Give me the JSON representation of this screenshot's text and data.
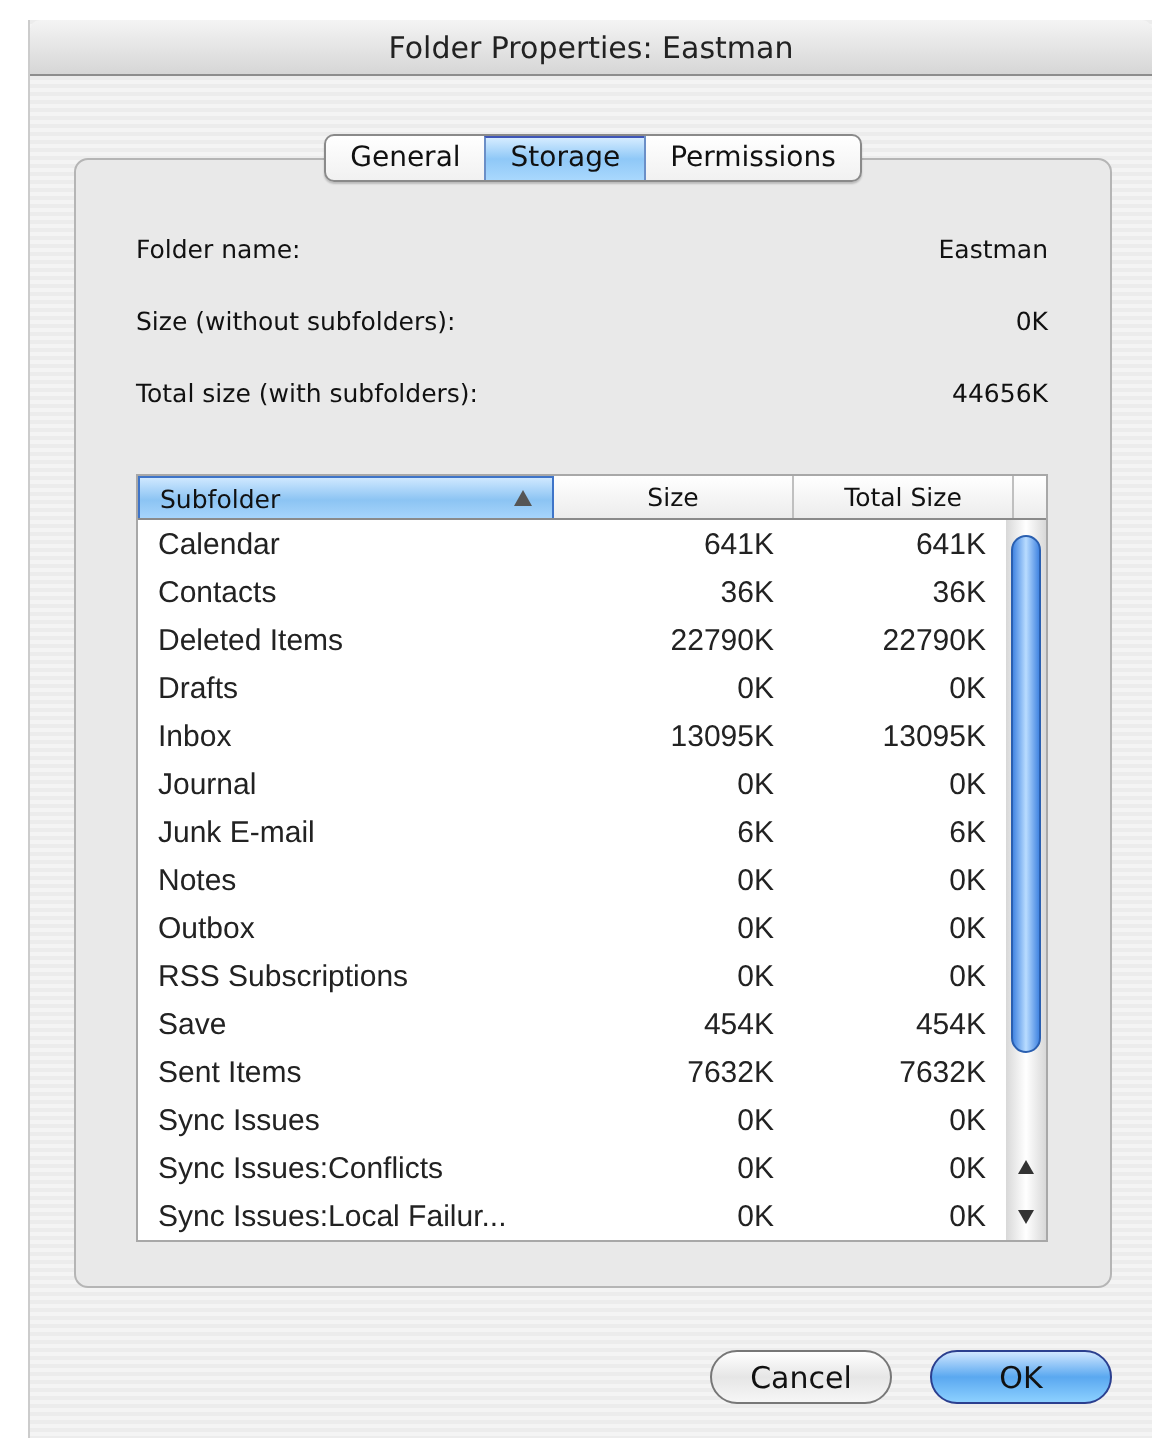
{
  "window": {
    "title": "Folder Properties: Eastman"
  },
  "tabs": [
    {
      "label": "General",
      "selected": false
    },
    {
      "label": "Storage",
      "selected": true
    },
    {
      "label": "Permissions",
      "selected": false
    }
  ],
  "info": [
    {
      "label": "Folder name:",
      "value": "Eastman"
    },
    {
      "label": "Size (without subfolders):",
      "value": "0K"
    },
    {
      "label": "Total size (with subfolders):",
      "value": "44656K"
    }
  ],
  "table": {
    "columns": [
      {
        "label": "Subfolder",
        "selected": true,
        "sorted": true
      },
      {
        "label": "Size",
        "selected": false,
        "sorted": false
      },
      {
        "label": "Total Size",
        "selected": false,
        "sorted": false
      }
    ],
    "rows": [
      [
        "Calendar",
        "641K",
        "641K"
      ],
      [
        "Contacts",
        "36K",
        "36K"
      ],
      [
        "Deleted Items",
        "22790K",
        "22790K"
      ],
      [
        "Drafts",
        "0K",
        "0K"
      ],
      [
        "Inbox",
        "13095K",
        "13095K"
      ],
      [
        "Journal",
        "0K",
        "0K"
      ],
      [
        "Junk E-mail",
        "6K",
        "6K"
      ],
      [
        "Notes",
        "0K",
        "0K"
      ],
      [
        "Outbox",
        "0K",
        "0K"
      ],
      [
        "RSS Subscriptions",
        "0K",
        "0K"
      ],
      [
        "Save",
        "454K",
        "454K"
      ],
      [
        "Sent Items",
        "7632K",
        "7632K"
      ],
      [
        "Sync Issues",
        "0K",
        "0K"
      ],
      [
        "Sync Issues:Conflicts",
        "0K",
        "0K"
      ],
      [
        "Sync Issues:Local Failur...",
        "0K",
        "0K"
      ]
    ]
  },
  "buttons": [
    {
      "label": "Cancel",
      "default": false
    },
    {
      "label": "OK",
      "default": true
    }
  ]
}
